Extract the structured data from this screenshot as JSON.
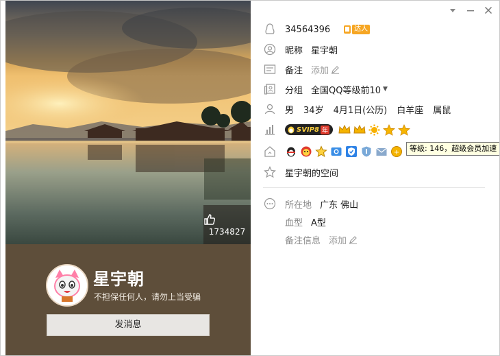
{
  "window": {
    "controls": {
      "dropdown": "chevron-down",
      "minimize": "minimize",
      "close": "close"
    }
  },
  "cover": {
    "like_count": "1734827"
  },
  "profile": {
    "display_name": "星宇朝",
    "signature": "不担保任何人，请勿上当受骗",
    "send_message_label": "发消息"
  },
  "info": {
    "qq_number": "34564396",
    "daren_badge": "达人",
    "nickname_label": "昵称",
    "nickname_value": "星宇朝",
    "remark_label": "备注",
    "remark_add": "添加",
    "group_label": "分组",
    "group_value": "全国QQ等级前10",
    "gender": "男",
    "age": "34岁",
    "birthday": "4月1日(公历)",
    "zodiac": "白羊座",
    "chinese_zodiac": "属鼠",
    "svip_label": "SVIP8",
    "svip_year": "年",
    "level_icons": [
      "crown",
      "crown",
      "sun",
      "star",
      "star"
    ],
    "qzone_link": "星宇朝的空间",
    "location_label": "所在地",
    "location_value": "广东 佛山",
    "blood_label": "血型",
    "blood_value": "A型",
    "remark_info_label": "备注信息",
    "remark_info_add": "添加"
  },
  "tooltip": {
    "text": "等级: 146，超级会员加速"
  },
  "colors": {
    "profile_bg": "#5e4e3a",
    "accent_orange": "#f6a623",
    "svip_gold": "#ffd23f"
  }
}
